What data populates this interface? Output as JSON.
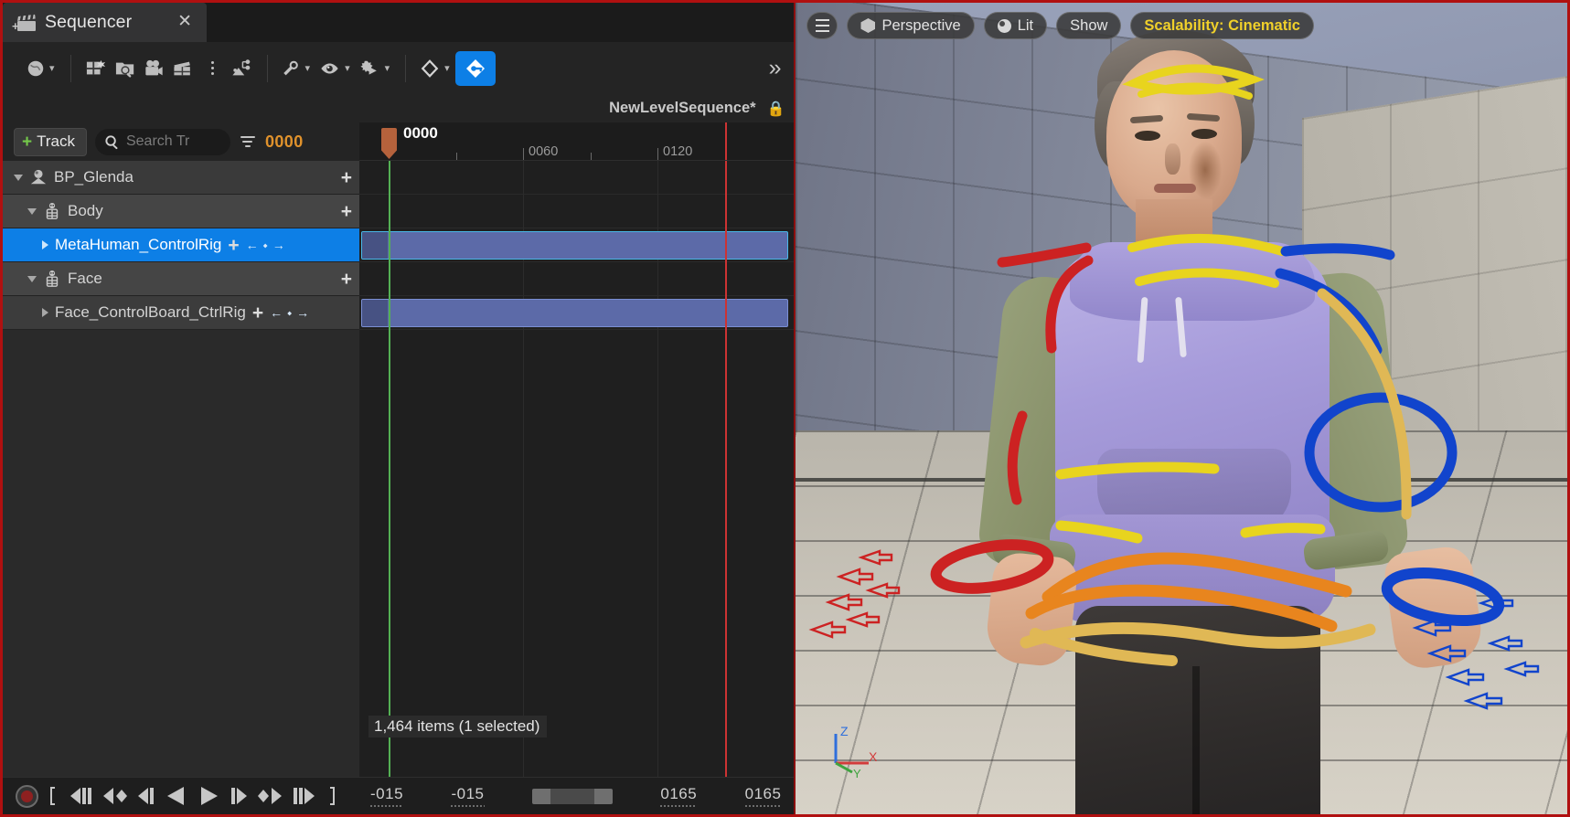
{
  "window": {
    "accent_blue": "#0d7fe6",
    "border_red": "#b01010"
  },
  "sequencer": {
    "tab": {
      "title": "Sequencer",
      "close_label": "✕",
      "icon": "clapperboard-add-icon"
    },
    "toolbar": {
      "world_icon": "globe-icon",
      "items": [
        {
          "name": "create-sequence-icon",
          "glyph": "new-clapper"
        },
        {
          "name": "open-sequence-icon",
          "glyph": "folder-search"
        },
        {
          "name": "create-camera-icon",
          "glyph": "movie-camera"
        },
        {
          "name": "render-movie-icon",
          "glyph": "clapper"
        },
        {
          "name": "more-options-icon",
          "glyph": "dots-vertical"
        },
        {
          "name": "actions-icon",
          "glyph": "image-tree"
        },
        {
          "name": "settings-icon",
          "glyph": "wrench"
        },
        {
          "name": "visibility-icon",
          "glyph": "eye"
        },
        {
          "name": "playback-options-icon",
          "glyph": "gear-play"
        },
        {
          "name": "keyframe-options-icon",
          "glyph": "diamond"
        },
        {
          "name": "auto-key-toggle-icon",
          "glyph": "diamond-key"
        },
        {
          "name": "overflow-chevrons-icon",
          "glyph": "double-chevron"
        }
      ]
    },
    "sequence_name": "NewLevelSequence*",
    "lock_icon": "lock-icon",
    "tree_toolbar": {
      "track_button": "Track",
      "track_button_plus": "+",
      "search_placeholder": "Search Tr",
      "filter_icon": "filter-icon",
      "current_frame": "0000",
      "frame_color": "#e0922c"
    },
    "tracks": [
      {
        "label": "BP_Glenda",
        "level": 0,
        "icon": "actor-icon",
        "expanded": true,
        "selected": false,
        "plus": "+",
        "has_nav": false,
        "has_section": false
      },
      {
        "label": "Body",
        "level": 1,
        "icon": "skeleton-icon",
        "expanded": true,
        "selected": false,
        "plus": "+",
        "has_nav": false,
        "has_section": false
      },
      {
        "label": "MetaHuman_ControlRig",
        "level": 2,
        "icon": "none",
        "expanded": false,
        "selected": true,
        "plus": "+",
        "has_nav": true,
        "has_section": true
      },
      {
        "label": "Face",
        "level": 1,
        "icon": "skeleton-icon",
        "expanded": true,
        "selected": false,
        "plus": "+",
        "has_nav": false,
        "has_section": false
      },
      {
        "label": "Face_ControlBoard_CtrlRig",
        "level": 2,
        "icon": "none",
        "expanded": false,
        "selected": false,
        "plus": "+",
        "has_nav": true,
        "has_section": true
      }
    ],
    "nav_arrows": {
      "prev": "←",
      "key": "⬩",
      "next": "→"
    },
    "timeline": {
      "playhead_label": "0000",
      "ruler_ticks": [
        {
          "label": "",
          "frame": 30
        },
        {
          "label": "0060",
          "frame": 60
        },
        {
          "label": "",
          "frame": 90
        },
        {
          "label": "0120",
          "frame": 120
        },
        {
          "label": "",
          "frame": 150
        }
      ],
      "playhead_frame": "0000",
      "section_color": "#5c6aa8",
      "selected_section_border": "#49b8e8",
      "playhead_color": "#54b054",
      "end_marker_color": "#cc3333"
    },
    "status": "1,464 items (1 selected)",
    "transport": {
      "record_icon": "record-icon",
      "buttons": [
        {
          "name": "jump-to-start-button",
          "glyph": "bracket-left"
        },
        {
          "name": "step-back-frames-button",
          "glyph": "prev-frames"
        },
        {
          "name": "previous-key-button",
          "glyph": "prev-key"
        },
        {
          "name": "step-back-button",
          "glyph": "step-back"
        },
        {
          "name": "play-reverse-button",
          "glyph": "play-reverse"
        },
        {
          "name": "play-forward-button",
          "glyph": "play-forward"
        },
        {
          "name": "step-forward-button",
          "glyph": "step-forward"
        },
        {
          "name": "next-key-button",
          "glyph": "next-key"
        },
        {
          "name": "step-forward-frames-button",
          "glyph": "next-frames"
        },
        {
          "name": "jump-to-end-button",
          "glyph": "bracket-right"
        }
      ],
      "range_start": "-015",
      "view_start": "-015",
      "view_end": "0165",
      "range_end": "0165"
    }
  },
  "viewport": {
    "menu_icon": "hamburger-icon",
    "view_mode": "Perspective",
    "view_mode_icon": "cube-icon",
    "lighting": "Lit",
    "lighting_icon": "sphere-icon",
    "show_menu": "Show",
    "scalability": "Scalability: Cinematic",
    "scalability_color": "#f0d02a",
    "gizmo": {
      "z": "Z",
      "x": "X",
      "y": "Y",
      "z_color": "#2f6fdc",
      "x_color": "#d23b3b",
      "y_color": "#3fa33f"
    },
    "character": "metahuman-female-character",
    "control_rig_colors": {
      "yellow": "#e8d41e",
      "red": "#cc2222",
      "blue": "#1144cc",
      "orange": "#e8851e",
      "tan": "#e0b855"
    }
  }
}
